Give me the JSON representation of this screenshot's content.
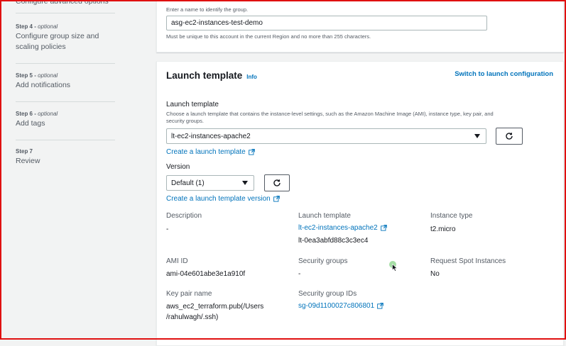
{
  "sidebar": {
    "partial_step_title": "Configure advanced options",
    "steps": [
      {
        "label": "Step 4 -",
        "optional": "optional",
        "title_line1": "Configure group size and",
        "title_line2": "scaling policies"
      },
      {
        "label": "Step 5 -",
        "optional": "optional",
        "title_line1": "Add notifications",
        "title_line2": ""
      },
      {
        "label": "Step 6 -",
        "optional": "optional",
        "title_line1": "Add tags",
        "title_line2": ""
      },
      {
        "label": "Step 7",
        "optional": "",
        "title_line1": "Review",
        "title_line2": ""
      }
    ]
  },
  "name_section": {
    "hint": "Enter a name to identify the group.",
    "value": "asg-ec2-instances-test-demo",
    "constraint": "Must be unique to this account in the current Region and no more than 255 characters."
  },
  "launch_template_section": {
    "header": "Launch template",
    "info": "Info",
    "switch_link": "Switch to launch configuration",
    "field_label": "Launch template",
    "field_description_line1": "Choose a launch template that contains the instance-level settings, such as the Amazon Machine Image (AMI), instance type, key pair, and",
    "field_description_line2": "security groups.",
    "selected_template": "lt-ec2-instances-apache2",
    "create_template_link": "Create a launch template",
    "version_label": "Version",
    "selected_version": "Default (1)",
    "create_version_link": "Create a launch template version",
    "details": {
      "description_label": "Description",
      "description_value": "-",
      "launch_template_label": "Launch template",
      "launch_template_link": "lt-ec2-instances-apache2",
      "launch_template_id": "lt-0ea3abfd88c3c3ec4",
      "instance_type_label": "Instance type",
      "instance_type_value": "t2.micro",
      "ami_label": "AMI ID",
      "ami_value": "ami-04e601abe3e1a910f",
      "security_groups_label": "Security groups",
      "security_groups_value": "-",
      "spot_label": "Request Spot Instances",
      "spot_value": "No",
      "key_pair_label": "Key pair name",
      "key_pair_line1": "aws_ec2_terraform.pub(/Users",
      "key_pair_line2": "/rahulwagh/.ssh)",
      "sg_ids_label": "Security group IDs",
      "sg_ids_link": "sg-09d1100027c806801"
    }
  },
  "colors": {
    "link": "#0073bb",
    "frame": "#e01010",
    "background": "#f2f3f3"
  }
}
